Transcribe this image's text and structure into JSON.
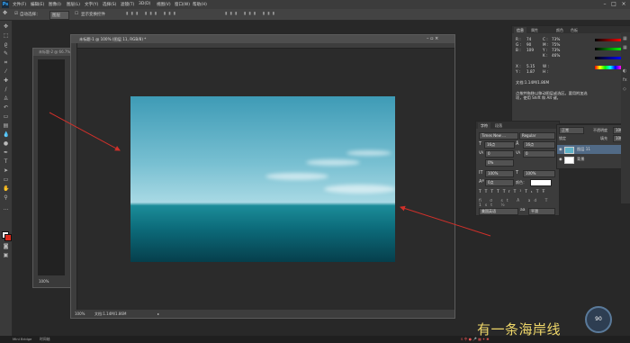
{
  "app": {
    "logo": "Ps"
  },
  "menu": [
    "文件(F)",
    "编辑(E)",
    "图像(I)",
    "图层(L)",
    "文字(Y)",
    "选择(S)",
    "滤镜(T)",
    "3D(D)",
    "视图(V)",
    "窗口(W)",
    "帮助(H)"
  ],
  "options_bar": {
    "auto_select_label": "自动选择：",
    "auto_select_value": "图层",
    "show_transform": "显示变换控件"
  },
  "doc_secondary": {
    "title": "未标题-2 @ 66.7%",
    "zoom": "100%"
  },
  "document": {
    "title": "未标题-1 @ 100% (图层 11, RGB/8) *",
    "zoom": "100%",
    "doc_size": "文档:1.14M/1.86M"
  },
  "info_panel": {
    "tabs": [
      "信息",
      "属性"
    ],
    "side_tabs": [
      "颜色",
      "色板"
    ],
    "rgb": {
      "r_label": "R :",
      "r": "74",
      "g_label": "G :",
      "g": "90",
      "b_label": "B :",
      "b": "109"
    },
    "cmyk": {
      "c_label": "C :",
      "c": "73%",
      "m_label": "M :",
      "m": "75%",
      "y_label": "Y :",
      "y": "73%",
      "k_label": "K :",
      "k": "46%"
    },
    "x_label": "X :",
    "x": "5.15",
    "y_label": "Y :",
    "y_val": "1.87",
    "w_label": "W :",
    "h_label": "H :",
    "doc_line": "文档:1.14M/1.86M",
    "hint": "点按并拖移以移动图层或选区。要用附加选项，使用 Shift 和 Alt 键。",
    "color_values": [
      "255",
      "255",
      "255"
    ]
  },
  "character_panel": {
    "tabs": [
      "字符",
      "段落"
    ],
    "font_family": "Times New ...",
    "font_style": "Regular",
    "font_size": "16点",
    "leading": "16点",
    "kerning": "0",
    "tracking": "0",
    "percent": "0%",
    "vscale": "100%",
    "hscale": "100%",
    "baseline": "0点",
    "color_label": "颜色：",
    "lang": "美国英语",
    "aa_label": "aa",
    "aa": "平滑",
    "styles": [
      "T",
      "T",
      "TT",
      "Tr",
      "T¹",
      "T₁",
      "T",
      "Ŧ"
    ]
  },
  "layers_panel": {
    "blend_mode": "正常",
    "opacity_label": "不透明度",
    "opacity": "100%",
    "fill_label": "填充",
    "fill": "100%",
    "lock_label": "锁定",
    "layers": [
      {
        "name": "图层 11"
      },
      {
        "name": "背景"
      }
    ]
  },
  "watermark": "有一条海岸线",
  "gauge": {
    "value": "90"
  },
  "taskbar": {
    "left": "Mini Bridge",
    "right": "时间轴"
  },
  "colors": {
    "accent": "#31a8ff",
    "arrow": "#d0302a"
  }
}
